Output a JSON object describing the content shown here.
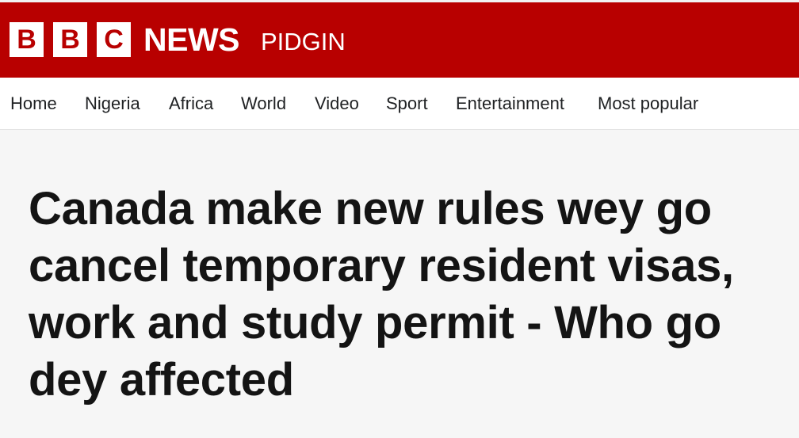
{
  "brand": {
    "letters": [
      "B",
      "B",
      "C"
    ],
    "news": "NEWS",
    "edition": "PIDGIN",
    "colors": {
      "brand_red": "#b80000",
      "logo_white": "#ffffff"
    }
  },
  "nav": {
    "items": [
      {
        "label": "Home"
      },
      {
        "label": "Nigeria"
      },
      {
        "label": "Africa"
      },
      {
        "label": "World"
      },
      {
        "label": "Video"
      },
      {
        "label": "Sport"
      },
      {
        "label": "Entertainment"
      },
      {
        "label": "Most popular"
      }
    ]
  },
  "article": {
    "headline": "Canada make new rules wey go cancel temporary resident visas, work and study permit - Who go dey affected"
  }
}
